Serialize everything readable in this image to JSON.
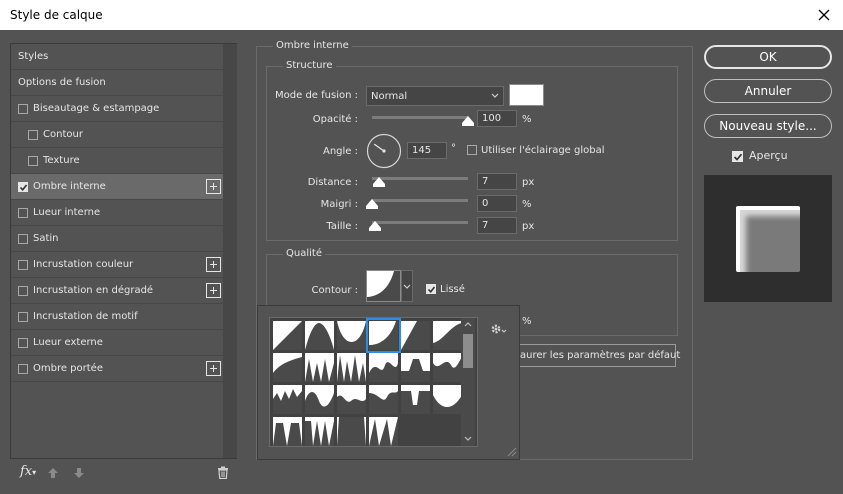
{
  "window": {
    "title": "Style de calque",
    "close_icon": "close-icon"
  },
  "sidebar": {
    "items": [
      {
        "label": "Styles",
        "checkbox": false,
        "checked": false,
        "plus": false,
        "selected": false,
        "indent": 0
      },
      {
        "label": "Options de fusion",
        "checkbox": false,
        "checked": false,
        "plus": false,
        "selected": false,
        "indent": 0
      },
      {
        "label": "Biseautage & estampage",
        "checkbox": true,
        "checked": false,
        "plus": false,
        "selected": false,
        "indent": 0
      },
      {
        "label": "Contour",
        "checkbox": true,
        "checked": false,
        "plus": false,
        "selected": false,
        "indent": 1
      },
      {
        "label": "Texture",
        "checkbox": true,
        "checked": false,
        "plus": false,
        "selected": false,
        "indent": 1
      },
      {
        "label": "Ombre interne",
        "checkbox": true,
        "checked": true,
        "plus": true,
        "selected": true,
        "indent": 0
      },
      {
        "label": "Lueur interne",
        "checkbox": true,
        "checked": false,
        "plus": false,
        "selected": false,
        "indent": 0
      },
      {
        "label": "Satin",
        "checkbox": true,
        "checked": false,
        "plus": false,
        "selected": false,
        "indent": 0
      },
      {
        "label": "Incrustation couleur",
        "checkbox": true,
        "checked": false,
        "plus": true,
        "selected": false,
        "indent": 0
      },
      {
        "label": "Incrustation en dégradé",
        "checkbox": true,
        "checked": false,
        "plus": true,
        "selected": false,
        "indent": 0
      },
      {
        "label": "Incrustation de motif",
        "checkbox": true,
        "checked": false,
        "plus": false,
        "selected": false,
        "indent": 0
      },
      {
        "label": "Lueur externe",
        "checkbox": true,
        "checked": false,
        "plus": false,
        "selected": false,
        "indent": 0
      },
      {
        "label": "Ombre portée",
        "checkbox": true,
        "checked": false,
        "plus": true,
        "selected": false,
        "indent": 0
      }
    ],
    "bottom_icons": {
      "fx": "fx",
      "up": "arrow-up-icon",
      "down": "arrow-down-icon",
      "trash": "trash-icon"
    }
  },
  "inner_shadow": {
    "group_title": "Ombre interne",
    "structure_title": "Structure",
    "blend_mode_label": "Mode de fusion :",
    "blend_mode_value": "Normal",
    "color_swatch": "#ffffff",
    "opacity_label": "Opacité :",
    "opacity_value": "100",
    "opacity_unit": "%",
    "opacity_level": 1.0,
    "angle_label": "Angle :",
    "angle_value": "145",
    "angle_unit": "°",
    "global_light_label": "Utiliser l'éclairage global",
    "global_light_checked": false,
    "distance_label": "Distance :",
    "distance_value": "7",
    "distance_unit": "px",
    "distance_level": 0.07,
    "choke_label": "Maigri :",
    "choke_value": "0",
    "choke_unit": "%",
    "choke_level": 0.0,
    "size_label": "Taille :",
    "size_value": "7",
    "size_unit": "px",
    "size_level": 0.03
  },
  "quality": {
    "title": "Qualité",
    "contour_label": "Contour :",
    "antialias_label": "Lissé",
    "antialias_checked": true,
    "noise_unit": "%",
    "reset_label": "aurer les paramètres par défaut"
  },
  "buttons": {
    "ok": "OK",
    "cancel": "Annuler",
    "new_style": "Nouveau style...",
    "preview_label": "Aperçu",
    "preview_checked": true
  },
  "contour_picker": {
    "gear_icon": "gear-icon",
    "selected_index": 3
  },
  "colors": {
    "bg": "#535353",
    "selected_row": "#6a6a6a",
    "accent": "#2d8ceb"
  }
}
